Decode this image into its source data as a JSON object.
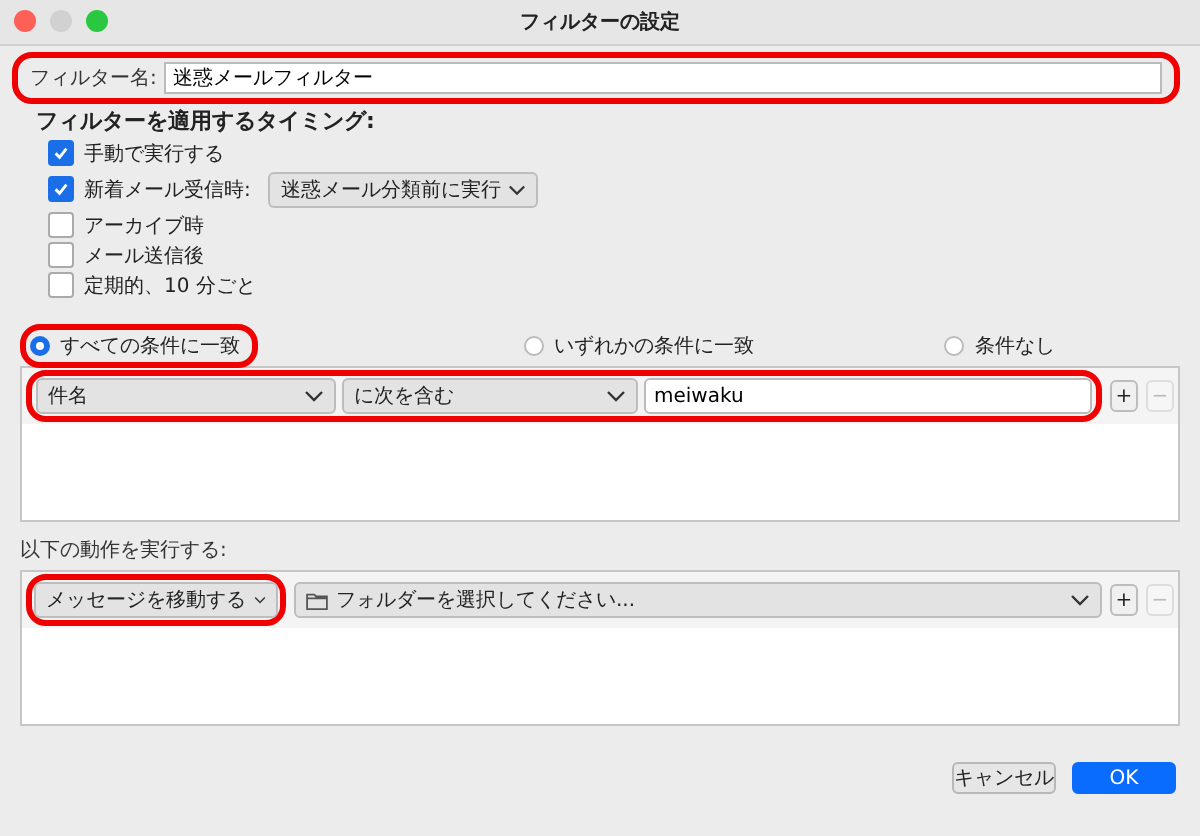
{
  "window": {
    "title": "フィルターの設定"
  },
  "filter_name": {
    "label": "フィルター名:",
    "value": "迷惑メールフィルター",
    "highlighted": true
  },
  "timing": {
    "heading": "フィルターを適用するタイミング:",
    "options": [
      {
        "label": "手動で実行する",
        "checked": true
      },
      {
        "label": "新着メール受信時:",
        "checked": true,
        "select": "迷惑メール分類前に実行"
      },
      {
        "label": "アーカイブ時",
        "checked": false
      },
      {
        "label": "メール送信後",
        "checked": false
      },
      {
        "label": "定期的、10 分ごと",
        "checked": false
      }
    ]
  },
  "match": [
    {
      "label": "すべての条件に一致",
      "selected": true,
      "highlighted": true
    },
    {
      "label": "いずれかの条件に一致",
      "selected": false,
      "highlighted": false
    },
    {
      "label": "条件なし",
      "selected": false,
      "highlighted": false
    }
  ],
  "conditions": [
    {
      "field": "件名",
      "operator": "に次を含む",
      "value": "meiwaku",
      "highlighted": true,
      "add": "+",
      "remove": "−",
      "remove_disabled": true
    }
  ],
  "actions_label": "以下の動作を実行する:",
  "actions": [
    {
      "action": "メッセージを移動する",
      "target": "フォルダーを選択してください...",
      "highlighted": true,
      "add": "+",
      "remove": "−",
      "remove_disabled": true
    }
  ],
  "buttons": [
    {
      "label": "キャンセル",
      "kind": "secondary"
    },
    {
      "label": "OK",
      "kind": "primary"
    }
  ]
}
